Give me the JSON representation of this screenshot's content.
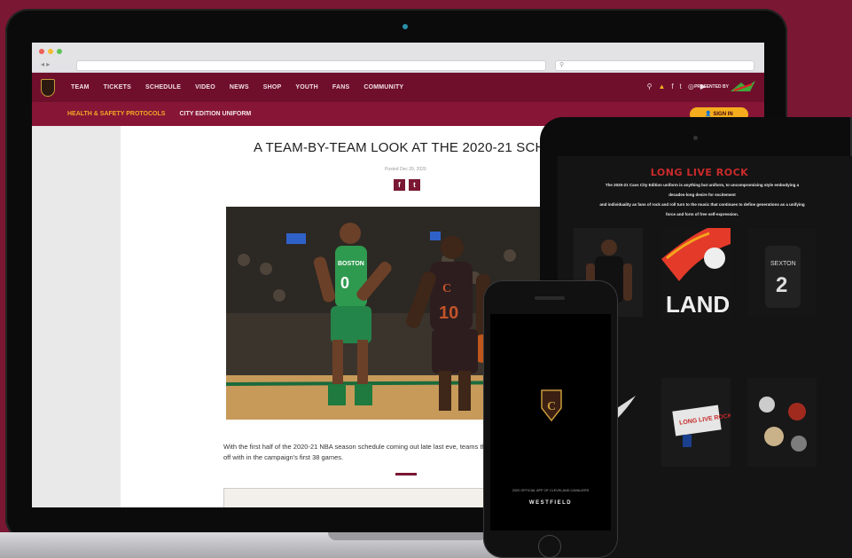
{
  "browser": {
    "nav_buttons": "◂ ▸",
    "search_placeholder": "⚲"
  },
  "site_nav": {
    "items": [
      "TEAM",
      "TICKETS",
      "SCHEDULE",
      "VIDEO",
      "NEWS",
      "SHOP",
      "YOUTH",
      "FANS",
      "COMMUNITY"
    ],
    "icons": [
      "search-icon",
      "alert-icon",
      "facebook-icon",
      "twitter-icon",
      "instagram-icon",
      "youtube-icon"
    ],
    "presented_by": "PRESENTED BY"
  },
  "subnav": {
    "items": [
      "HEALTH & SAFETY PROTOCOLS",
      "CITY EDITION UNIFORM"
    ],
    "active_index": 0,
    "sign_in": "👤  SIGN IN"
  },
  "article": {
    "title": "A TEAM-BY-TEAM LOOK AT THE 2020-21 SCHEDU",
    "posted": "Posted Dec 29, 2020",
    "share": [
      "f",
      "t"
    ],
    "body": "With the first half of the 2020-21 NBA season schedule coming out late last eve, teams the Wine & Gold will face off with in the campaign's first 38 games."
  },
  "hero_image": {
    "player_left_number": "0",
    "player_left_team": "BOSTON",
    "player_right_number": "10"
  },
  "tablet": {
    "headline": "LONG LIVE ROCK",
    "intro_line1": "The 2020-21 Cavs City Edition uniform is anything but uniform, to uncompromising style embodying a",
    "intro_line2": "decades-long desire for excitement",
    "intro_line3": "and individuality as fans of rock and roll turn to the music that continues to define generations as a unifying",
    "intro_line4": "force and form of free self-expression."
  },
  "phone": {
    "caption": "2020 OFFICIAL APP OF CLEVELAND CAVALIERS",
    "sponsor": "WESTFIELD"
  },
  "colors": {
    "brand_wine": "#7a1733",
    "nav_bg": "#6f0f2c",
    "gold": "#f6ad1d",
    "rock_red": "#cc2a2a"
  }
}
